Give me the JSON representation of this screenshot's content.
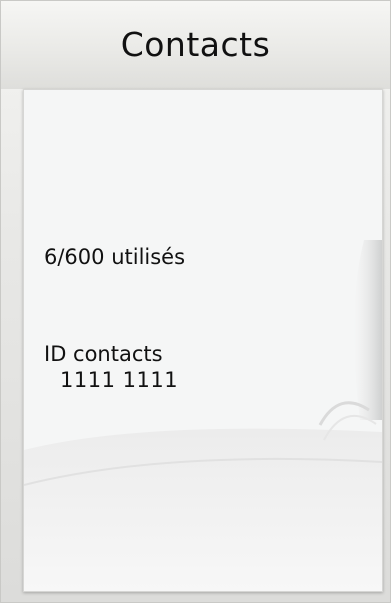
{
  "header": {
    "title": "Contacts"
  },
  "panel": {
    "usage_text": "6/600 utilisés",
    "id_label": "ID contacts",
    "id_value": "1111 1111"
  }
}
